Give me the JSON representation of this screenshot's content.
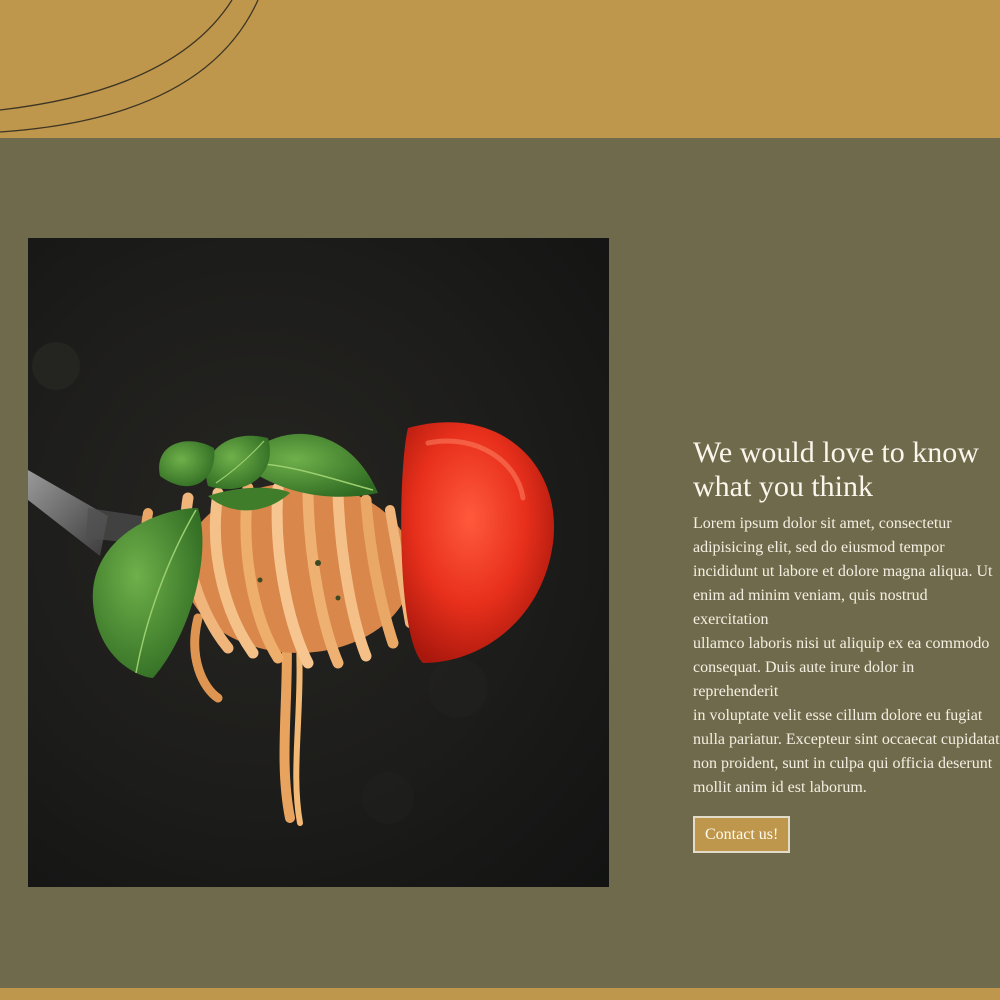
{
  "colors": {
    "gold": "#bf974c",
    "olive": "#706a4c",
    "heading_text": "#fbf6ec",
    "photo_background": "#1c1c1a"
  },
  "hero_image": {
    "subject": "photo-spaghetti-on-fork-with-basil-and-tomato"
  },
  "contact_section": {
    "heading": "We would love to know\nwhat you think",
    "body": "Lorem ipsum dolor sit amet, consectetur\nadipisicing elit, sed do eiusmod tempor\nincididunt ut labore et dolore magna aliqua. Ut\nenim ad minim veniam, quis nostrud exercitation\nullamco laboris nisi ut aliquip ex ea commodo\nconsequat. Duis aute irure dolor in reprehenderit\nin voluptate velit esse cillum dolore eu fugiat\nnulla pariatur. Excepteur sint occaecat cupidatat\nnon proident, sunt in culpa qui officia deserunt\nmollit anim id est laborum.",
    "button_label": "Contact us!"
  }
}
